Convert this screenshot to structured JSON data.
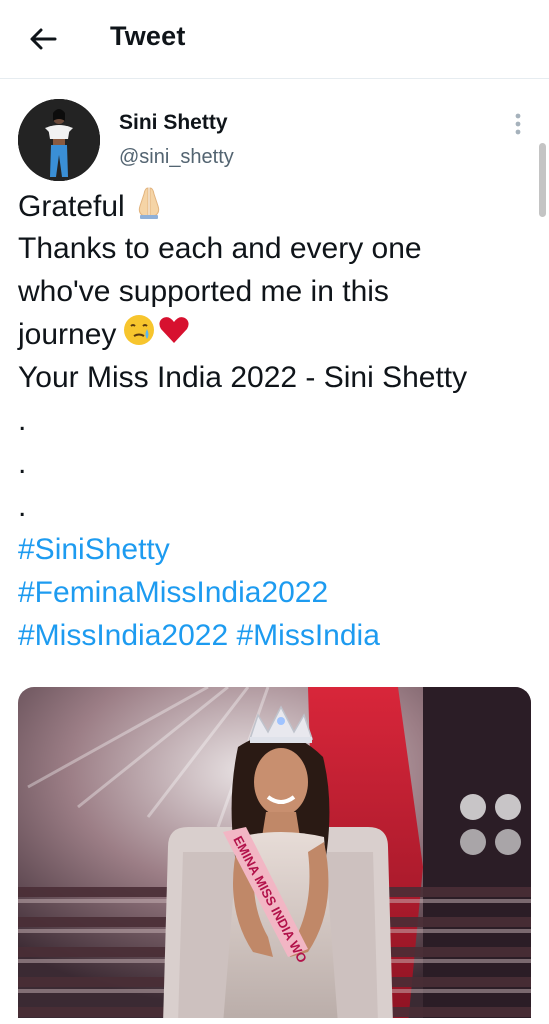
{
  "header": {
    "title": "Tweet",
    "back_icon": "arrow-left-icon"
  },
  "tweet": {
    "author_name": "Sini Shetty",
    "author_handle": "@sini_shetty",
    "more_icon": "more-vertical-icon",
    "text_lines": {
      "l1": "Grateful",
      "l2": "Thanks to each and every one",
      "l3": "who've supported me in this",
      "l4": "journey",
      "l5": "Your Miss India 2022 - Sini Shetty",
      "dot1": ".",
      "dot2": ".",
      "dot3": "."
    },
    "hashtags": {
      "h1": "#SiniShetty",
      "h2": "#FeminaMissIndia2022",
      "h3": "#MissIndia2022",
      "h4": "#MissIndia"
    },
    "emojis": [
      "folded-hands-icon",
      "crying-face-icon",
      "red-heart-icon"
    ],
    "media": {
      "sash_text": "EMINA MISS INDIA WO"
    }
  },
  "colors": {
    "text": "#0f1419",
    "secondary": "#536471",
    "link": "#1d9bf0",
    "divider": "#e6ecf0"
  }
}
